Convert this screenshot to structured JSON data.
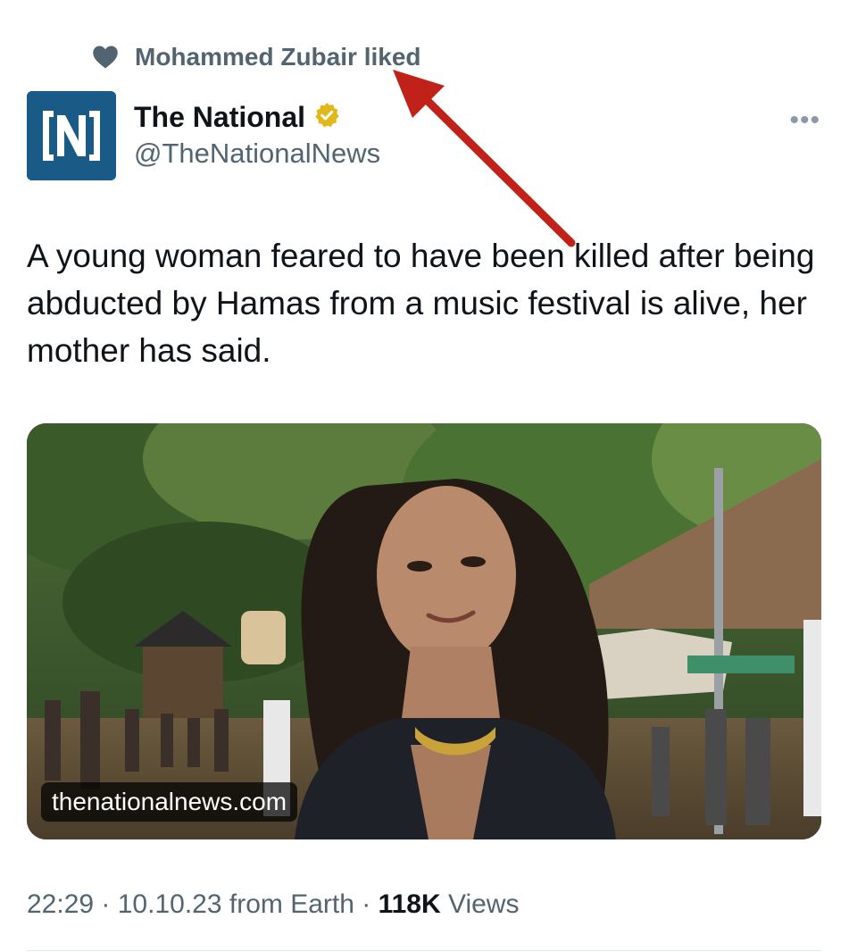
{
  "social_context": {
    "icon": "heart-icon",
    "text": "Mohammed Zubair liked"
  },
  "author": {
    "avatar_letter": "N",
    "display_name": "The National",
    "verified_badge": "verified-gold-badge-icon",
    "handle": "@TheNationalNews"
  },
  "more_menu": "•••",
  "tweet": {
    "text": "A young woman feared to have been killed after being abducted by Hamas from a music festival is alive, her mother has said."
  },
  "media": {
    "label": "thenationalnews.com"
  },
  "meta": {
    "time": "22:29",
    "sep1": " · ",
    "date": "10.10.23",
    "source": " from Earth",
    "sep2": " · ",
    "views_count": "118K",
    "views_label": " Views"
  },
  "colors": {
    "arrow": "#c0221a",
    "brand_blue": "#1a5a86",
    "verified_gold": "#e2b719",
    "secondary_text": "#536471"
  }
}
